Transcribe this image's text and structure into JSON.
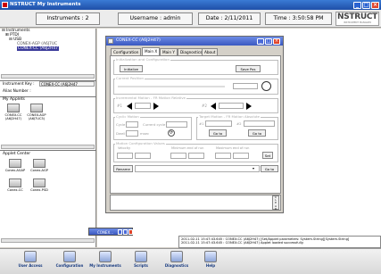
{
  "window": {
    "title": "NSTRUCT   My Instruments"
  },
  "infobar": {
    "instruments": "Instruments : 2",
    "username": "Username : admin",
    "date": "Date : 2/11/2011",
    "time": "Time : 3:50:58 PM",
    "brand": "NSTRUCT",
    "brand_sub": "INSTRUMENT MANAGER"
  },
  "tree": {
    "root": "Instruments",
    "n1": "PTDI",
    "n2": "USB",
    "n3": "CONEX-AGP (A6J7UC",
    "n4": "CONEX-CC (A6J2H47"
  },
  "props": {
    "key_label": "Instrument Key :",
    "key_value": "CONEX-CC (A6J2H47",
    "alias_label": "Alias Number :"
  },
  "applets": {
    "header": "My Applets",
    "items": [
      {
        "label": "CONEX-CC (A6J2H47)"
      },
      {
        "label": "CONEX-AGP (A6J7UC5)"
      }
    ]
  },
  "center": {
    "header": "Applet Center",
    "items": [
      {
        "label": "Conex-AGAP"
      },
      {
        "label": "Conex-AGP"
      },
      {
        "label": "Conex-CC"
      },
      {
        "label": "Conex-PSD"
      }
    ]
  },
  "dialog": {
    "title": "CONEX-CC (A6J2H47)",
    "tabs": [
      "Configuration",
      "Main X",
      "Main Y",
      "Diagnostics",
      "About"
    ],
    "init_group": "Initialization and Configuration",
    "init_btn": "Initialize",
    "save_btn": "Save Pos",
    "current_pos": "Current Position",
    "inc_group": "Incremental Motion - FR Motion Relative",
    "cyclic_group": "Cyclic Motion",
    "cycle": "Cycle",
    "current_cycle": "Current cycle",
    "dwell": "Dwell",
    "ms": "msec",
    "target_group": "Target Motion - FR Motion Absolute",
    "goto1": "Go to",
    "goto2": "Go to",
    "motion_group": "Motion Configuration Values",
    "velocity": "Velocity",
    "minmax": "Minimum end of run",
    "maxend": "Maximum end of run",
    "set_btn": "Set",
    "rename_btn": "Rename",
    "goto3": "Go to",
    "clear": "C L E A R"
  },
  "minwin": {
    "title": "CONEX..."
  },
  "log": {
    "line1": "2011-02-11 15:47:43.645 : CONEX-CC (A6J2H47) [Set/Applet parameters: System.String][System.String]",
    "line2": "2011-02-11 15:47:43.645 : CONEX-CC (A6J2H47) Applet loaded successfully."
  },
  "taskbar": {
    "items": [
      {
        "label": "User Access"
      },
      {
        "label": "Configuration"
      },
      {
        "label": "My Instruments"
      },
      {
        "label": "Scripts"
      },
      {
        "label": "Diagnostics"
      },
      {
        "label": "Help"
      }
    ]
  }
}
